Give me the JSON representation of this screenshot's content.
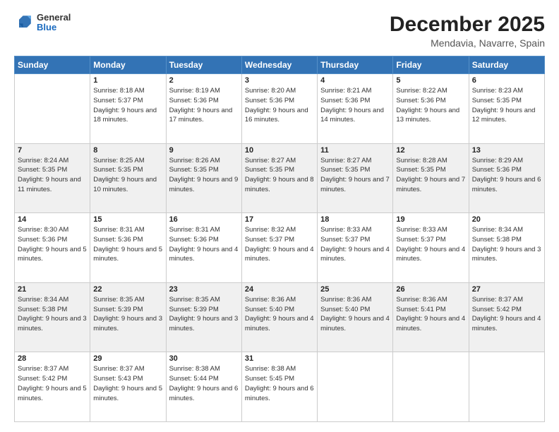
{
  "logo": {
    "line1": "General",
    "line2": "Blue"
  },
  "title": "December 2025",
  "subtitle": "Mendavia, Navarre, Spain",
  "header": {
    "days": [
      "Sunday",
      "Monday",
      "Tuesday",
      "Wednesday",
      "Thursday",
      "Friday",
      "Saturday"
    ]
  },
  "weeks": [
    {
      "days": [
        {
          "num": "",
          "sunrise": "",
          "sunset": "",
          "daylight": ""
        },
        {
          "num": "1",
          "sunrise": "Sunrise: 8:18 AM",
          "sunset": "Sunset: 5:37 PM",
          "daylight": "Daylight: 9 hours and 18 minutes."
        },
        {
          "num": "2",
          "sunrise": "Sunrise: 8:19 AM",
          "sunset": "Sunset: 5:36 PM",
          "daylight": "Daylight: 9 hours and 17 minutes."
        },
        {
          "num": "3",
          "sunrise": "Sunrise: 8:20 AM",
          "sunset": "Sunset: 5:36 PM",
          "daylight": "Daylight: 9 hours and 16 minutes."
        },
        {
          "num": "4",
          "sunrise": "Sunrise: 8:21 AM",
          "sunset": "Sunset: 5:36 PM",
          "daylight": "Daylight: 9 hours and 14 minutes."
        },
        {
          "num": "5",
          "sunrise": "Sunrise: 8:22 AM",
          "sunset": "Sunset: 5:36 PM",
          "daylight": "Daylight: 9 hours and 13 minutes."
        },
        {
          "num": "6",
          "sunrise": "Sunrise: 8:23 AM",
          "sunset": "Sunset: 5:35 PM",
          "daylight": "Daylight: 9 hours and 12 minutes."
        }
      ]
    },
    {
      "days": [
        {
          "num": "7",
          "sunrise": "Sunrise: 8:24 AM",
          "sunset": "Sunset: 5:35 PM",
          "daylight": "Daylight: 9 hours and 11 minutes."
        },
        {
          "num": "8",
          "sunrise": "Sunrise: 8:25 AM",
          "sunset": "Sunset: 5:35 PM",
          "daylight": "Daylight: 9 hours and 10 minutes."
        },
        {
          "num": "9",
          "sunrise": "Sunrise: 8:26 AM",
          "sunset": "Sunset: 5:35 PM",
          "daylight": "Daylight: 9 hours and 9 minutes."
        },
        {
          "num": "10",
          "sunrise": "Sunrise: 8:27 AM",
          "sunset": "Sunset: 5:35 PM",
          "daylight": "Daylight: 9 hours and 8 minutes."
        },
        {
          "num": "11",
          "sunrise": "Sunrise: 8:27 AM",
          "sunset": "Sunset: 5:35 PM",
          "daylight": "Daylight: 9 hours and 7 minutes."
        },
        {
          "num": "12",
          "sunrise": "Sunrise: 8:28 AM",
          "sunset": "Sunset: 5:35 PM",
          "daylight": "Daylight: 9 hours and 7 minutes."
        },
        {
          "num": "13",
          "sunrise": "Sunrise: 8:29 AM",
          "sunset": "Sunset: 5:36 PM",
          "daylight": "Daylight: 9 hours and 6 minutes."
        }
      ]
    },
    {
      "days": [
        {
          "num": "14",
          "sunrise": "Sunrise: 8:30 AM",
          "sunset": "Sunset: 5:36 PM",
          "daylight": "Daylight: 9 hours and 5 minutes."
        },
        {
          "num": "15",
          "sunrise": "Sunrise: 8:31 AM",
          "sunset": "Sunset: 5:36 PM",
          "daylight": "Daylight: 9 hours and 5 minutes."
        },
        {
          "num": "16",
          "sunrise": "Sunrise: 8:31 AM",
          "sunset": "Sunset: 5:36 PM",
          "daylight": "Daylight: 9 hours and 4 minutes."
        },
        {
          "num": "17",
          "sunrise": "Sunrise: 8:32 AM",
          "sunset": "Sunset: 5:37 PM",
          "daylight": "Daylight: 9 hours and 4 minutes."
        },
        {
          "num": "18",
          "sunrise": "Sunrise: 8:33 AM",
          "sunset": "Sunset: 5:37 PM",
          "daylight": "Daylight: 9 hours and 4 minutes."
        },
        {
          "num": "19",
          "sunrise": "Sunrise: 8:33 AM",
          "sunset": "Sunset: 5:37 PM",
          "daylight": "Daylight: 9 hours and 4 minutes."
        },
        {
          "num": "20",
          "sunrise": "Sunrise: 8:34 AM",
          "sunset": "Sunset: 5:38 PM",
          "daylight": "Daylight: 9 hours and 3 minutes."
        }
      ]
    },
    {
      "days": [
        {
          "num": "21",
          "sunrise": "Sunrise: 8:34 AM",
          "sunset": "Sunset: 5:38 PM",
          "daylight": "Daylight: 9 hours and 3 minutes."
        },
        {
          "num": "22",
          "sunrise": "Sunrise: 8:35 AM",
          "sunset": "Sunset: 5:39 PM",
          "daylight": "Daylight: 9 hours and 3 minutes."
        },
        {
          "num": "23",
          "sunrise": "Sunrise: 8:35 AM",
          "sunset": "Sunset: 5:39 PM",
          "daylight": "Daylight: 9 hours and 3 minutes."
        },
        {
          "num": "24",
          "sunrise": "Sunrise: 8:36 AM",
          "sunset": "Sunset: 5:40 PM",
          "daylight": "Daylight: 9 hours and 4 minutes."
        },
        {
          "num": "25",
          "sunrise": "Sunrise: 8:36 AM",
          "sunset": "Sunset: 5:40 PM",
          "daylight": "Daylight: 9 hours and 4 minutes."
        },
        {
          "num": "26",
          "sunrise": "Sunrise: 8:36 AM",
          "sunset": "Sunset: 5:41 PM",
          "daylight": "Daylight: 9 hours and 4 minutes."
        },
        {
          "num": "27",
          "sunrise": "Sunrise: 8:37 AM",
          "sunset": "Sunset: 5:42 PM",
          "daylight": "Daylight: 9 hours and 4 minutes."
        }
      ]
    },
    {
      "days": [
        {
          "num": "28",
          "sunrise": "Sunrise: 8:37 AM",
          "sunset": "Sunset: 5:42 PM",
          "daylight": "Daylight: 9 hours and 5 minutes."
        },
        {
          "num": "29",
          "sunrise": "Sunrise: 8:37 AM",
          "sunset": "Sunset: 5:43 PM",
          "daylight": "Daylight: 9 hours and 5 minutes."
        },
        {
          "num": "30",
          "sunrise": "Sunrise: 8:38 AM",
          "sunset": "Sunset: 5:44 PM",
          "daylight": "Daylight: 9 hours and 6 minutes."
        },
        {
          "num": "31",
          "sunrise": "Sunrise: 8:38 AM",
          "sunset": "Sunset: 5:45 PM",
          "daylight": "Daylight: 9 hours and 6 minutes."
        },
        {
          "num": "",
          "sunrise": "",
          "sunset": "",
          "daylight": ""
        },
        {
          "num": "",
          "sunrise": "",
          "sunset": "",
          "daylight": ""
        },
        {
          "num": "",
          "sunrise": "",
          "sunset": "",
          "daylight": ""
        }
      ]
    }
  ]
}
